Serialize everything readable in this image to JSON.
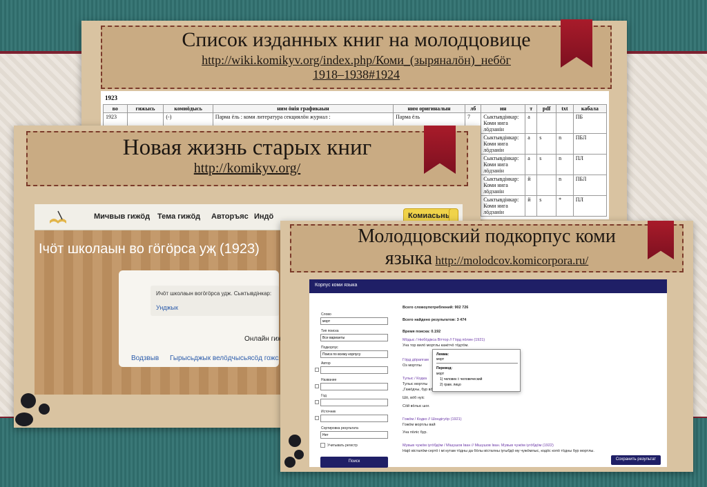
{
  "card1": {
    "title": "Список изданных книг на молодцовице",
    "link_line1": "http://wiki.komikyv.org/index.php/Коми_(зыряналӧн)_небӧг",
    "link_line2": "1918–1938#1924",
    "year": "1923",
    "headers": [
      "во",
      "гижысь",
      "комиӧдысь",
      "ним öнія графикаын",
      "ним оригиналын",
      "лб",
      "ин",
      "т",
      "pdf",
      "txt",
      "кабала"
    ],
    "rows": [
      {
        "vo": "1923",
        "c1": "",
        "c2": "(-)",
        "c3": "Парма ёль : коми литература секциялӧн журнал :",
        "c4": "Парма ёль",
        "lb": "7",
        "in": "Сыктывдінкар: Коми нига лӧдзанін",
        "t": "а",
        "pdf": "",
        "txt": "",
        "kab": "ПБ"
      },
      {
        "vo": "",
        "c1": "",
        "c2": "",
        "c3": "",
        "c4": "",
        "lb": "68",
        "in": "Сыктывдінкар: Коми нига лӧдзанін",
        "t": "а",
        "pdf": "s",
        "txt": "n",
        "kab": "ПБЛ"
      },
      {
        "vo": "",
        "c1": "",
        "c2": "",
        "c3": "",
        "c4": "",
        "lb": "44",
        "in": "Сыктывдінкар: Коми нига лӧдзанін",
        "t": "а",
        "pdf": "s",
        "txt": "n",
        "kab": "ПЛ"
      },
      {
        "vo": "",
        "c1": "",
        "c2": "",
        "c3": "",
        "c4": "",
        "lb": "24",
        "in": "Сыктывдінкар: Коми нига лӧдзанін",
        "t": "й",
        "pdf": "",
        "txt": "n",
        "kab": "ПБЛ"
      },
      {
        "vo": "",
        "c1": "",
        "c2": "",
        "c3": "",
        "c4": "",
        "lb": "22",
        "in": "Сыктывдінкар: Коми нига лӧдзанін",
        "t": "й",
        "pdf": "s",
        "txt": "*",
        "kab": "ПЛ"
      }
    ]
  },
  "card2": {
    "title": "Новая жизнь старых книг",
    "link": "http://komikyv.org/",
    "nav": [
      "Мичвыв гижӧд",
      "Тема гижӧд",
      "Авторъяс",
      "Индӧ"
    ],
    "btn": "Комиасьны",
    "heading": "Ічӧт школаын во гӧгӧрса уҗ (1923)",
    "desc": "Ичӧт школаын вогӧгӧрса удж. Сыктывдінкар:",
    "link_text": "Унджык",
    "online": "Онлайн гиж",
    "footer1": "Водзвыв",
    "footer2": "Гырысьджык велӧдчысьясӧд гожся у"
  },
  "card3": {
    "title": "Молодцовский подкорпус коми",
    "title2": "языка",
    "link": "http://molodcov.komicorpora.ru/",
    "header": "Корпус коми языка",
    "form": {
      "word_label": "Слово",
      "word_value": "морт",
      "type_label": "Тип поиска",
      "type_value": "Все варианты",
      "sub_label": "Подкорпус",
      "sub_value": "Поиск по всему корпусу",
      "author_label": "Автор",
      "name_label": "Название",
      "year_label": "Год",
      "source_label": "Источник",
      "sort_label": "Сортировка результата",
      "sort_value": "Нет",
      "register_label": "Учитывать регистр",
      "search_btn": "Поиск"
    },
    "stats": {
      "total": "Всего словоупотреблений: 902 726",
      "found": "Всего найдено результатов: 3 474",
      "time": "Время поиска: 0.192"
    },
    "results": [
      {
        "head": "Мӧдыс / Нюбӧдікса Віттор // Гӧрд пӧлин (1921)",
        "line": "Уна тор вилӧ мортлы кажітчӧ тӧдтӧм."
      },
      {
        "head": "Гӧрд дӧрапгам",
        "line": "Оз мортлы"
      },
      {
        "head": "Тулыс / Кодка",
        "line": "Тулыс мортлы"
      },
      {
        "head": "",
        "line": "„Гажӧдчы, бур вӧв!"
      },
      {
        "head": "",
        "line": "Шӧ, вӧб нуіс"
      },
      {
        "head": "",
        "line": "Сӧй вӧлыс шог."
      },
      {
        "head": "Гожӧм / Кодко // Шондігуӧр (1921)",
        "line": "Гожӧм мортлы вай"
      },
      {
        "head": "",
        "line": "Уна пӧліс бур."
      },
      {
        "head": "Мувыв чужӧм іугӧбдӧм / Мішушов Іван // Мішушов Іван. Мувыв чужӧм іугӧбдӧм (1922)",
        "line": "Најӧ вісталӧм-сертӧ і мі кутам тӧдны да бӧлы вісталны іугыбдӧ му чужӧмлыс, кодӧс копӧ тӧдны бур мортлы."
      }
    ],
    "popup": {
      "lemma_label": "Лемма:",
      "lemma_value": "морт",
      "trans_label": "Перевод:",
      "trans_word": "морт",
      "sense1": "1) человек ◊ человеческий",
      "sense2": "2) грам. лицо"
    },
    "save_btn": "Сохранить результат"
  }
}
